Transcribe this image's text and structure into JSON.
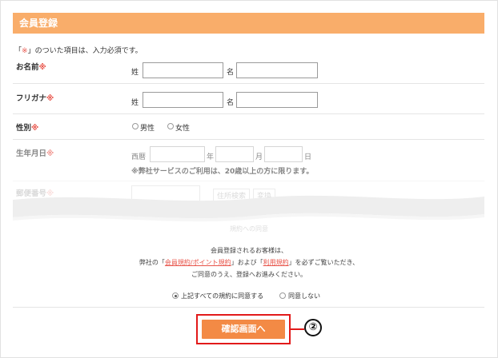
{
  "header": {
    "title": "会員登録"
  },
  "note": {
    "open_bracket": "「",
    "mark": "※",
    "close_text": "」のついた項目は、入力必須です。"
  },
  "rows": {
    "name": {
      "label": "お名前",
      "mark": "※",
      "sei": "姓",
      "mei": "名"
    },
    "furigana": {
      "label": "フリガナ",
      "mark": "※",
      "sei": "姓",
      "mei": "名"
    },
    "gender": {
      "label": "性別",
      "mark": "※",
      "male": "男性",
      "female": "女性"
    },
    "birth": {
      "label": "生年月日",
      "mark": "※",
      "era": "西暦",
      "year": "年",
      "month": "月",
      "day": "日",
      "warning": "※弊社サービスのご利用は、20歳以上の方に限ります。"
    },
    "postal": {
      "label": "郵便番号",
      "mark": "※",
      "btn1": "住所検索",
      "btn2": "変換"
    },
    "faded": {
      "text": "規約への同意"
    }
  },
  "terms": {
    "line1": "会員登録されるお客様は、",
    "line2_pre": "弊社の「",
    "link1": "会員規約/ポイント規約",
    "line2_mid": "」および「",
    "link2": "利用規約",
    "line2_post": "」を必ずご覧いただき、",
    "line3": "ご同意のうえ、登録へお進みください。"
  },
  "agree": {
    "yes": "上記すべての規約に同意する",
    "no": "同意しない"
  },
  "submit": {
    "label": "確認画面へ"
  },
  "callout": {
    "number": "②"
  },
  "colors": {
    "accent": "#f9ad6a",
    "button": "#f38a45",
    "required": "#e8544a",
    "highlight": "#e21a1a"
  }
}
